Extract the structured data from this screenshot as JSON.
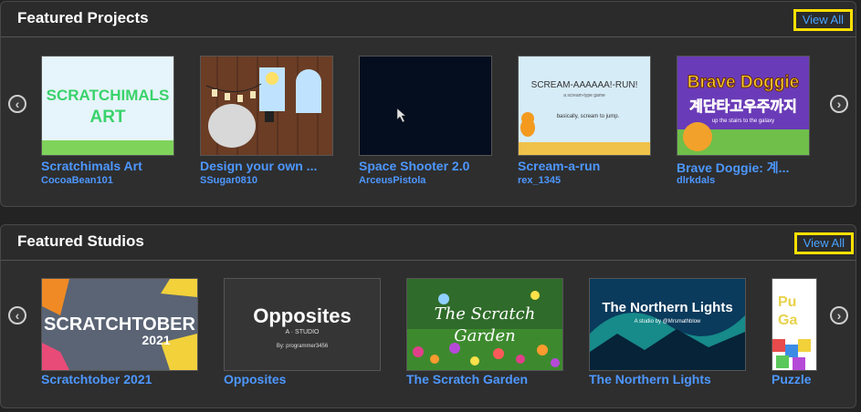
{
  "featured_projects": {
    "title": "Featured Projects",
    "view_all_label": "View All",
    "items": [
      {
        "title": "Scratchimals Art",
        "author": "CocoaBean101",
        "thumb_text_1": "SCRATCHIMALS",
        "thumb_text_2": "ART"
      },
      {
        "title": "Design your own ...",
        "author": "SSugar0810"
      },
      {
        "title": "Space Shooter 2.0",
        "author": "ArceusPistola"
      },
      {
        "title": "Scream-a-run",
        "author": "rex_1345",
        "thumb_text_1": "SCREAM-AAAAAA!-RUN!",
        "thumb_text_2": "a scream-type game",
        "thumb_text_3": "basically, scream to jump."
      },
      {
        "title": "Brave Doggie: 계...",
        "author": "dlrkdals",
        "thumb_text_1": "Brave Doggie",
        "thumb_text_2": "계단타고우주까지",
        "thumb_text_3": "up the stairs to the galaxy"
      }
    ]
  },
  "featured_studios": {
    "title": "Featured Studios",
    "view_all_label": "View All",
    "items": [
      {
        "title": "Scratchtober 2021",
        "thumb_text_1": "SCRATCHTOBER",
        "thumb_text_2": "2021"
      },
      {
        "title": "Opposites",
        "thumb_text_1": "Opposites",
        "thumb_text_2": "A · STUDIO",
        "thumb_text_3": "By: programmer3456"
      },
      {
        "title": "The Scratch Garden",
        "thumb_text_1": "The Scratch",
        "thumb_text_2": "Garden"
      },
      {
        "title": "The Northern Lights",
        "thumb_text_1": "The Northern Lights",
        "thumb_text_2": "A studio by @Mrsmathblow"
      },
      {
        "title": "Puzzle",
        "thumb_text_1": "Pu",
        "thumb_text_2": "Ga"
      }
    ]
  },
  "icons": {
    "prev": "chevron-left-circle-icon",
    "next": "chevron-right-circle-icon"
  },
  "colors": {
    "link": "#4d97ff",
    "highlight": "#ffe000"
  }
}
